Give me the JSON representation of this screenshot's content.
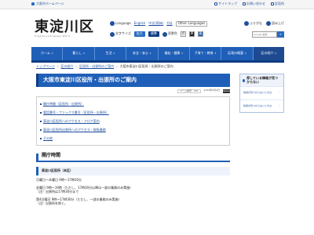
{
  "topbar": {
    "osaka_link": "大阪市ホームページ",
    "links": [
      {
        "label": "サイトマップ",
        "icon": "sitemap-icon"
      },
      {
        "label": "お問い合わせ",
        "icon": "mail-icon"
      },
      {
        "label": "区役所",
        "icon": "building-icon"
      }
    ]
  },
  "header": {
    "logo_kanji": "東淀川区",
    "logo_roman": "Higashiyodogawa Ward",
    "language_label": "Language",
    "languages": [
      "English",
      "中文(简体)",
      "한글",
      "Other Languages"
    ],
    "furigana": "ふりがな",
    "read_aloud": "読み上げ",
    "font_size_label": "文字サイズ",
    "font_size_options": [
      "拡大",
      "標準"
    ],
    "bg_label": "背景色",
    "bg_options": [
      "白",
      "黒",
      "青"
    ],
    "search_placeholder": "Google 提供",
    "search_button": "検索"
  },
  "nav": {
    "items": [
      "ホーム",
      "暮らし",
      "生活",
      "安全・安心",
      "福祉・健康",
      "子育て・教育",
      "区政の概要",
      "区の紹介"
    ]
  },
  "breadcrumb": {
    "items": [
      "トップページ",
      "区の紹介",
      "区役所・出張所のご案内"
    ],
    "current": "大阪市東淀川区役所・出張所のご案内"
  },
  "main": {
    "title": "大阪市東淀川区役所・出張所のご案内",
    "page_id": "ページ番号：407",
    "updated": "2024年6月4日",
    "share": "Share",
    "toc": [
      "開庁時間（区役所・出張所）",
      "電話番号・ファックス番号（区役所・出張所）",
      "東淀川区役所へのアクセス・フロア案内",
      "東淀川区役所出張所へのアクセス・取扱業務",
      "その他"
    ],
    "section_title": "開庁時間",
    "sub_title": "東淀川区役所（本区）",
    "paragraphs": [
      "月曜日～木曜日 9時～17時30分",
      "金曜日 9時～19時（ただし、17時30分以降は一部の業務のみ実施）",
      "（注）出張所は17時30分まで",
      "第4日曜日 9時～17時30分（ただし、一部の業務のみ実施）",
      "（注）出張所を除く。"
    ]
  },
  "sidebar": {
    "header": "探している情報が見つからない",
    "items": [
      "情報が見つからないときは",
      "情報が見つからないときは"
    ]
  }
}
